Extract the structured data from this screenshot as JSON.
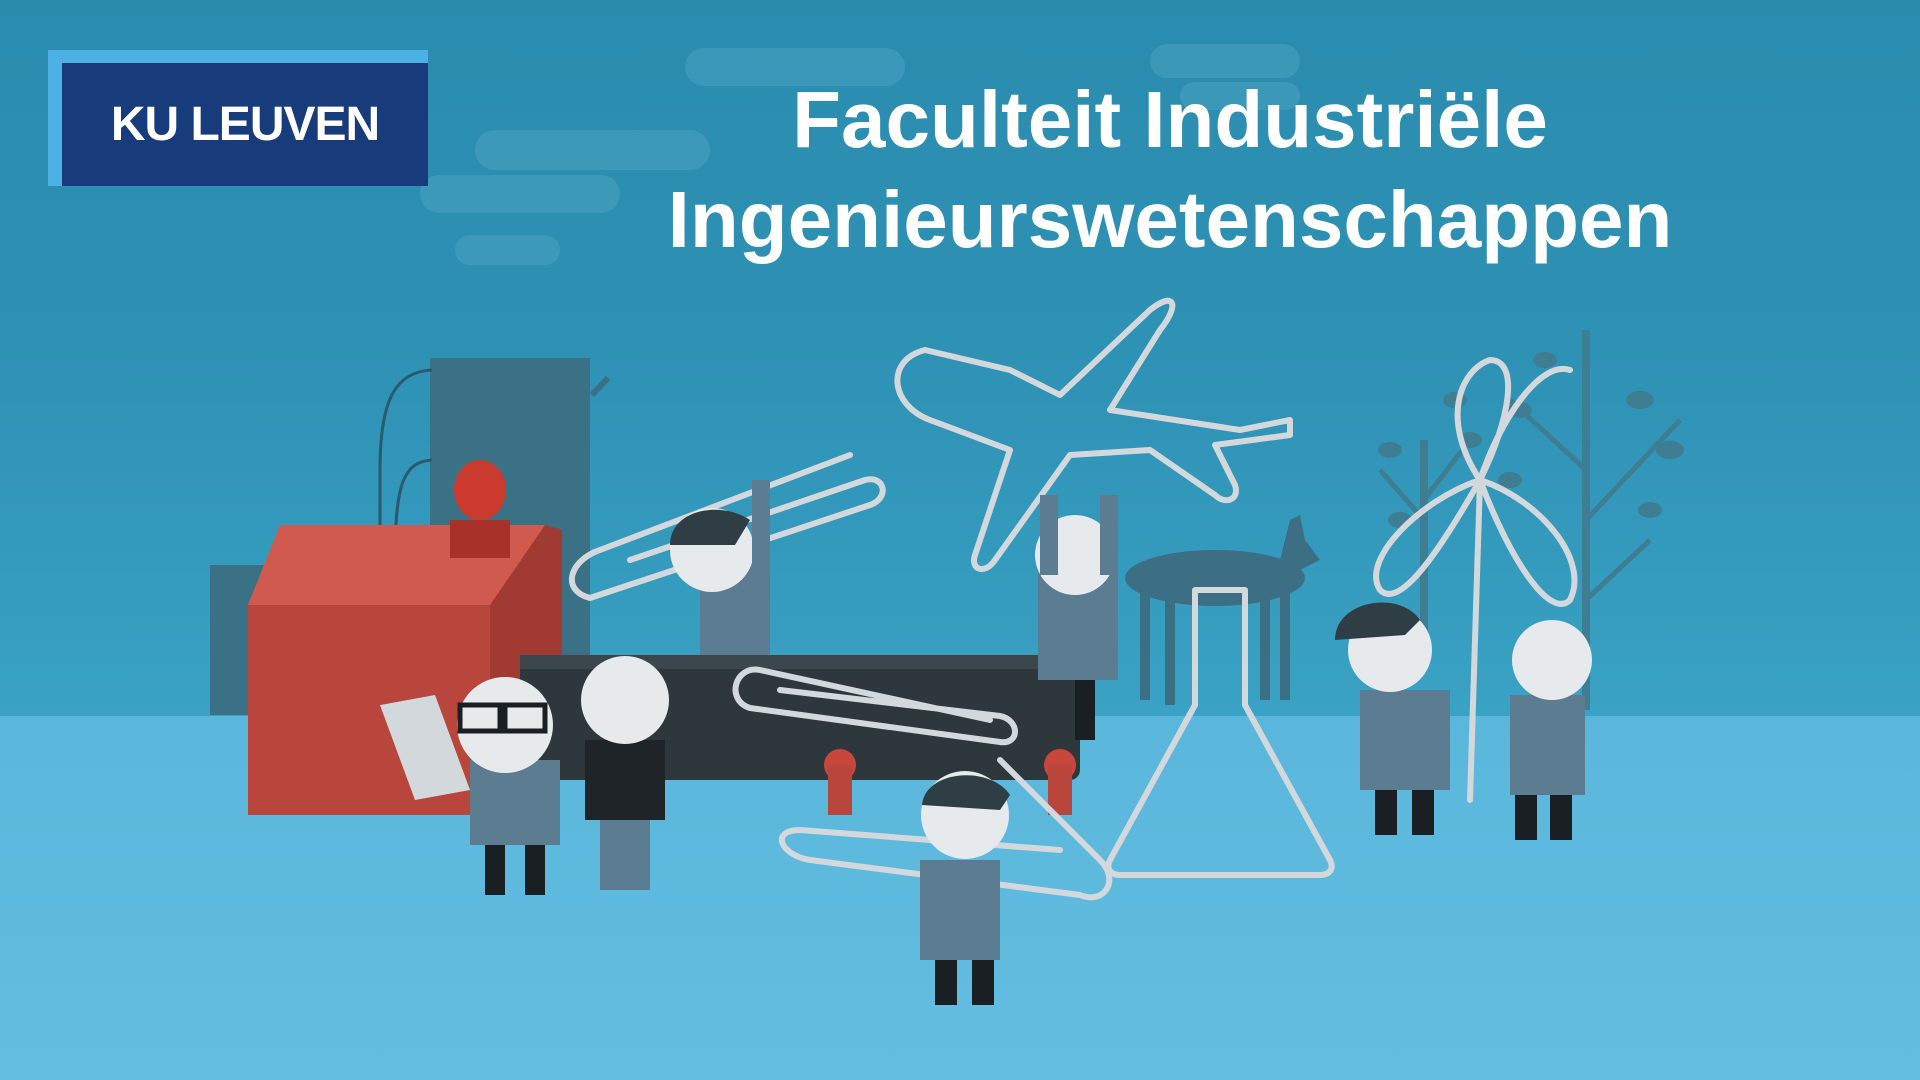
{
  "logo": {
    "text": "KU LEUVEN"
  },
  "title": {
    "line1": "Faculteit Industriële",
    "line2": "Ingenieurswetenschappen"
  },
  "colors": {
    "sky": "#2e8fb1",
    "ground": "#5ab7db",
    "logo_bg": "#173b7b",
    "logo_accent": "#4db1e6",
    "house": "#c94d43",
    "outline": "#d9dde0",
    "figure": "#5c7c91"
  }
}
